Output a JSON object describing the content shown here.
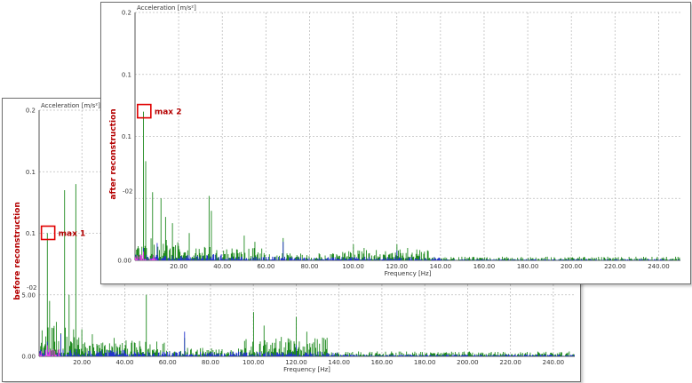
{
  "chart_data": [
    {
      "type": "line",
      "ylabel": "Acceleration [m/s²]",
      "xlabel": "Frequency [Hz]",
      "side_label": "before reconstruction",
      "marker_label": "max 1",
      "marker_point": [
        4,
        0.1
      ],
      "xlim": [
        0,
        250
      ],
      "ylim": [
        0,
        0.2
      ],
      "x_ticks": [
        "20.00",
        "40.00",
        "60.00",
        "80.00",
        "100.00",
        "120.00",
        "140.00",
        "160.00",
        "180.00",
        "200.00",
        "220.00",
        "240.00"
      ],
      "y_ticks": [
        {
          "v": 0.2,
          "label": "0.2"
        },
        {
          "v": 0.15,
          "label": "0.1"
        },
        {
          "v": 0.1,
          "label": "0.1"
        },
        {
          "v": 0.05,
          "label": "5.00"
        },
        {
          "v": 0.0,
          "label": "0.00"
        }
      ],
      "ytick_exp": "-02",
      "grid": true,
      "series": [
        {
          "color": "#1f8a1f",
          "peaks": [
            [
              4,
              0.1
            ],
            [
              5,
              0.045
            ],
            [
              8,
              0.028
            ],
            [
              12,
              0.135
            ],
            [
              14,
              0.05
            ],
            [
              17,
              0.14
            ],
            [
              20,
              0.022
            ],
            [
              25,
              0.018
            ],
            [
              35,
              0.015
            ],
            [
              50,
              0.05
            ],
            [
              55,
              0.012
            ],
            [
              68,
              0.015
            ],
            [
              100,
              0.036
            ],
            [
              105,
              0.025
            ],
            [
              120,
              0.032
            ],
            [
              125,
              0.02
            ],
            [
              130,
              0.014
            ]
          ],
          "noise": [
            [
              0,
              20,
              0.025
            ],
            [
              20,
              60,
              0.013
            ],
            [
              60,
              95,
              0.007
            ],
            [
              95,
              135,
              0.016
            ],
            [
              135,
              250,
              0.004
            ]
          ]
        },
        {
          "color": "#2233cc",
          "peaks": [
            [
              4,
              0.012
            ],
            [
              10,
              0.018
            ],
            [
              68,
              0.02
            ],
            [
              120,
              0.009
            ]
          ],
          "noise": [
            [
              0,
              40,
              0.006
            ],
            [
              40,
              140,
              0.004
            ],
            [
              140,
              250,
              0.0015
            ]
          ]
        },
        {
          "color": "#e040e0",
          "peaks": [
            [
              4,
              0.009
            ]
          ],
          "noise": [
            [
              0,
              10,
              0.006
            ]
          ]
        }
      ]
    },
    {
      "type": "line",
      "ylabel": "Acceleration [m/s²]",
      "xlabel": "Frequency [Hz]",
      "side_label": "after reconstruction",
      "marker_label": "max 2",
      "marker_point": [
        4,
        0.12
      ],
      "xlim": [
        0,
        250
      ],
      "ylim": [
        0,
        0.2
      ],
      "x_ticks": [
        "20.00",
        "40.00",
        "60.00",
        "80.00",
        "100.00",
        "120.00",
        "140.00",
        "160.00",
        "180.00",
        "200.00",
        "220.00",
        "240.00"
      ],
      "y_ticks": [
        {
          "v": 0.2,
          "label": "0.2"
        },
        {
          "v": 0.15,
          "label": "0.1"
        },
        {
          "v": 0.1,
          "label": "0.1"
        },
        {
          "v": 0.05,
          "label": ""
        },
        {
          "v": 0.0,
          "label": "0.00"
        }
      ],
      "ytick_exp": "-02",
      "grid": true,
      "series": [
        {
          "color": "#1f8a1f",
          "peaks": [
            [
              4,
              0.12
            ],
            [
              5,
              0.08
            ],
            [
              8,
              0.055
            ],
            [
              12,
              0.05
            ],
            [
              14,
              0.035
            ],
            [
              17,
              0.03
            ],
            [
              25,
              0.022
            ],
            [
              34,
              0.052
            ],
            [
              35,
              0.04
            ],
            [
              50,
              0.02
            ],
            [
              55,
              0.015
            ],
            [
              68,
              0.018
            ],
            [
              100,
              0.013
            ],
            [
              105,
              0.01
            ],
            [
              120,
              0.013
            ],
            [
              125,
              0.01
            ]
          ],
          "noise": [
            [
              0,
              20,
              0.018
            ],
            [
              20,
              60,
              0.011
            ],
            [
              60,
              95,
              0.006
            ],
            [
              95,
              135,
              0.009
            ],
            [
              135,
              250,
              0.003
            ]
          ]
        },
        {
          "color": "#2233cc",
          "peaks": [
            [
              4,
              0.01
            ],
            [
              10,
              0.014
            ],
            [
              68,
              0.015
            ],
            [
              120,
              0.008
            ]
          ],
          "noise": [
            [
              0,
              40,
              0.005
            ],
            [
              40,
              140,
              0.003
            ],
            [
              140,
              250,
              0.001
            ]
          ]
        },
        {
          "color": "#e040e0",
          "peaks": [
            [
              4,
              0.007
            ]
          ],
          "noise": [
            [
              0,
              10,
              0.005
            ]
          ]
        }
      ]
    }
  ]
}
